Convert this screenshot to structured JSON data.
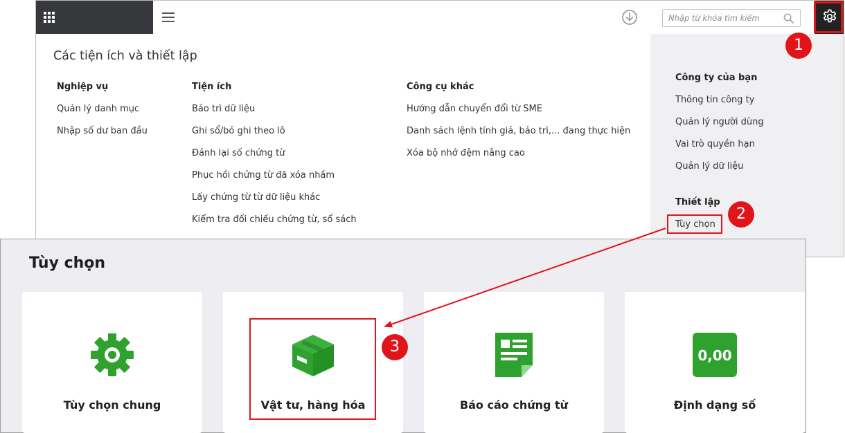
{
  "header": {
    "search_placeholder": "Nhập từ khóa tìm kiếm"
  },
  "utilities": {
    "title": "Các tiện ích và thiết lập",
    "columns": [
      {
        "heading": "Nghiệp vụ",
        "items": [
          "Quản lý danh mục",
          "Nhập số dư ban đầu"
        ]
      },
      {
        "heading": "Tiện ích",
        "items": [
          "Bảo trì dữ liệu",
          "Ghi sổ/bỏ ghi theo lô",
          "Đánh lại số chứng từ",
          "Phục hồi chứng từ đã xóa nhầm",
          "Lấy chứng từ từ dữ liệu khác",
          "Kiểm tra đối chiếu chứng từ, sổ sách"
        ]
      },
      {
        "heading": "Công cụ khác",
        "items": [
          "Hướng dẫn chuyển đổi từ SME",
          "Danh sách lệnh tính giá, bảo trì,... đang thực hiện",
          "Xóa bộ nhớ đệm nâng cao"
        ]
      }
    ]
  },
  "company_panel": {
    "heading": "Công ty của bạn",
    "items": [
      "Thông tin công ty",
      "Quản lý người dùng",
      "Vai trò quyền hạn",
      "Quản lý dữ liệu"
    ],
    "settings_heading": "Thiết lập",
    "settings_items": [
      "Tùy chọn"
    ]
  },
  "callouts": [
    "1",
    "2",
    "3"
  ],
  "options": {
    "title": "Tùy chọn",
    "cards": [
      {
        "label": "Tùy chọn chung",
        "icon": "gear-icon"
      },
      {
        "label": "Vật tư, hàng hóa",
        "icon": "box-icon"
      },
      {
        "label": "Báo cáo chứng từ",
        "icon": "document-icon"
      },
      {
        "label": "Định dạng số",
        "icon": "number-format-icon",
        "badge": "0,00"
      }
    ]
  },
  "colors": {
    "accent_red": "#e0141b",
    "icon_green": "#2ea12e",
    "dark_tile": "#37383c"
  }
}
